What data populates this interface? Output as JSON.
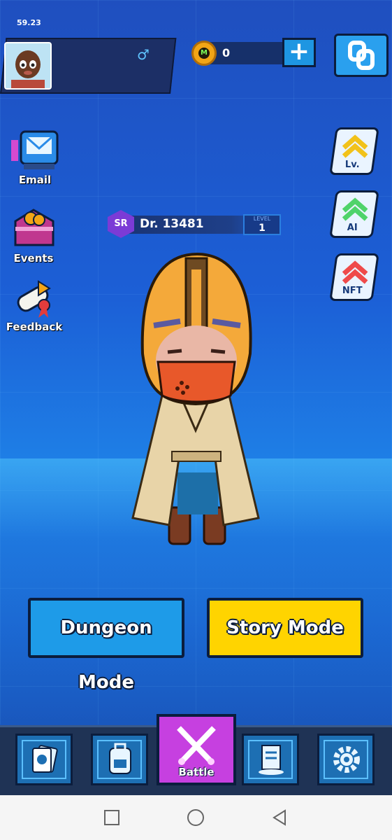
{
  "status": {
    "time": "59.23"
  },
  "profile": {
    "gender_symbol": "♂"
  },
  "currency": {
    "amount": "0"
  },
  "left_menu": [
    {
      "label": "Email",
      "icon": "email-icon"
    },
    {
      "label": "Events",
      "icon": "events-chest-icon"
    },
    {
      "label": "Feedback",
      "icon": "feedback-scroll-icon"
    }
  ],
  "right_menu": [
    {
      "label": "Lv.",
      "icon": "level-up-icon"
    },
    {
      "label": "AI",
      "icon": "ai-up-icon"
    },
    {
      "label": "NFT",
      "icon": "nft-up-icon"
    }
  ],
  "character": {
    "rarity": "SR",
    "name": "Dr. 13481",
    "level_label": "LEVEL",
    "level": "1"
  },
  "modes": {
    "dungeon": "Dungeon Mode",
    "story": "Story Mode"
  },
  "bottom_tabs": {
    "battle": "Battle"
  },
  "colors": {
    "dungeon_button": "#1e9be8",
    "story_button": "#ffd400",
    "battle_tab": "#c640e0"
  }
}
